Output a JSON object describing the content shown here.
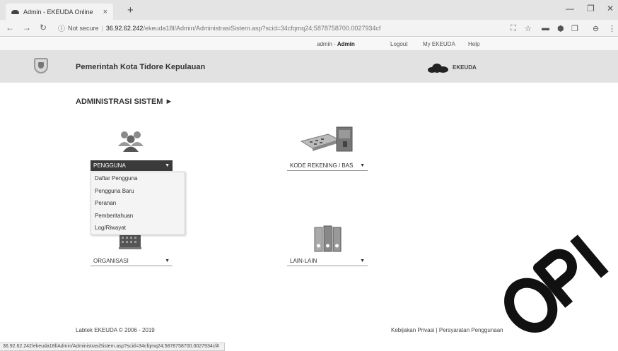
{
  "browser": {
    "tab_title": "Admin - EKEUDA Online",
    "tab_close": "×",
    "new_tab": "+",
    "url_secure_label": "Not secure",
    "url_host": "36.92.62.242",
    "url_path": "/ekeuda18l/Admin/AdministrasiSistem.asp?scid=34cfqmq24;5878758700.0027934cf",
    "status_url": "36.92.62.242/ekeuda18l/Admin/AdministrasiSistem.asp?scid=34cfqmq24;5878758700.0027934cf#"
  },
  "topnav": {
    "user_prefix": "admin - ",
    "user_role": "Admin",
    "logout": "Logout",
    "my_ekeuda": "My EKEUDA",
    "help": "Help"
  },
  "header": {
    "gov_title": "Pemerintah Kota Tidore Kepulauan",
    "logo_text": "EKEUDA"
  },
  "page": {
    "section_title": "ADMINISTRASI SISTEM ►"
  },
  "modules": {
    "pengguna": "PENGGUNA",
    "kode_rekening": "KODE REKENING / BAS",
    "organisasi": "ORGANISASI",
    "lain_lain": "LAIN-LAIN"
  },
  "pengguna_menu": {
    "items": [
      "Daftar Pengguna",
      "Pengguna Baru",
      "Peranan",
      "Pemberitahuan",
      "Log/Riwayat"
    ]
  },
  "footer": {
    "copyright": "Labtek EKEUDA © 2006 - 2019",
    "links": "Kebijakan Privasi | Persyaratan Penggunaan"
  },
  "icons": {
    "pengguna": "users-group-icon",
    "kode_rekening": "calculator-cashbox-icon",
    "organisasi": "building-icon",
    "lain_lain": "binders-icon"
  }
}
